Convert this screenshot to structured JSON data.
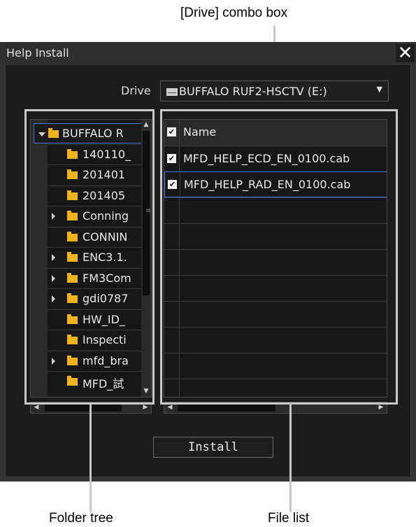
{
  "annotations": {
    "drive_combo": "[Drive] combo box",
    "folder_tree": "Folder tree",
    "file_list": "File list"
  },
  "dialog": {
    "title": "Help Install",
    "close_icon": "✕"
  },
  "drive": {
    "label": "Drive",
    "value": "BUFFALO RUF2-HSCTV (E:)",
    "icon": "drive-icon"
  },
  "folder_tree": {
    "items": [
      {
        "label": "BUFFALO R",
        "expander": "open",
        "level": 0
      },
      {
        "label": "140110_",
        "expander": "none",
        "level": 1
      },
      {
        "label": "201401",
        "expander": "none",
        "level": 1
      },
      {
        "label": "201405",
        "expander": "none",
        "level": 1
      },
      {
        "label": "Conning",
        "expander": "closed",
        "level": 1
      },
      {
        "label": "CONNIN",
        "expander": "none",
        "level": 1
      },
      {
        "label": "ENC3.1.",
        "expander": "closed",
        "level": 1
      },
      {
        "label": "FM3Com",
        "expander": "closed",
        "level": 1
      },
      {
        "label": "gdi0787",
        "expander": "closed",
        "level": 1
      },
      {
        "label": "HW_ID_",
        "expander": "none",
        "level": 1
      },
      {
        "label": "Inspecti",
        "expander": "none",
        "level": 1
      },
      {
        "label": "mfd_bra",
        "expander": "closed",
        "level": 1
      },
      {
        "label": "MFD_試",
        "expander": "none",
        "level": 1
      }
    ]
  },
  "file_list": {
    "header": "Name",
    "header_checked": true,
    "rows": [
      {
        "name": "MFD_HELP_ECD_EN_0100.cab",
        "checked": true,
        "selected": false
      },
      {
        "name": "MFD_HELP_RAD_EN_0100.cab",
        "checked": true,
        "selected": true
      }
    ],
    "empty_rows": 8
  },
  "install_button": "Install",
  "colors": {
    "background": "#1c1c1c",
    "selection_border": "#3d7ad8",
    "folder": "#f1b416",
    "callout_frame": "#c8c8c8"
  }
}
